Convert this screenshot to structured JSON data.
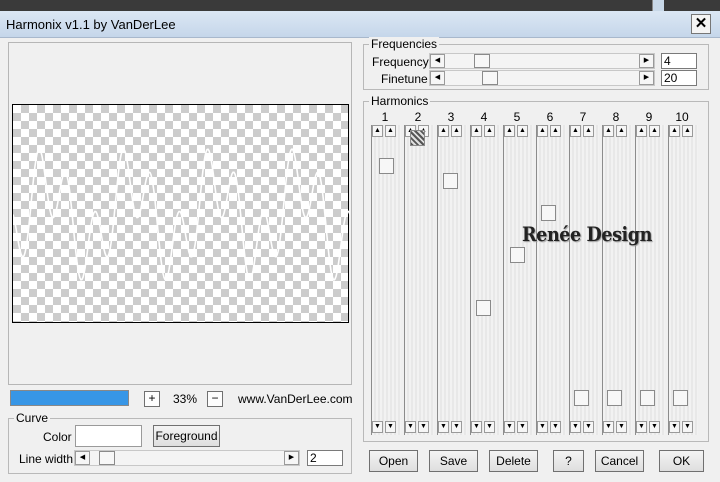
{
  "window": {
    "title": "Harmonix v1.1 by VanDerLee",
    "close_glyph": "✕"
  },
  "preview": {
    "progress": 1.0
  },
  "zoom": {
    "plus": "+",
    "value": "33%",
    "minus": "−"
  },
  "website": "www.VanDerLee.com",
  "curve": {
    "legend": "Curve",
    "color_label": "Color",
    "foreground_button": "Foreground",
    "line_width_label": "Line width",
    "line_width_value": "2"
  },
  "frequencies": {
    "legend": "Frequencies",
    "frequency_label": "Frequency",
    "frequency_value": "4",
    "finetune_label": "Finetune",
    "finetune_value": "20"
  },
  "harmonics": {
    "legend": "Harmonics",
    "columns": [
      "1",
      "2",
      "3",
      "4",
      "5",
      "6",
      "7",
      "8",
      "9",
      "10"
    ]
  },
  "watermark": "Renée Design",
  "buttons": {
    "open": "Open",
    "save": "Save",
    "delete": "Delete",
    "help": "?",
    "cancel": "Cancel",
    "ok": "OK"
  },
  "icons": {
    "arrow_left": "◀",
    "arrow_right": "▶",
    "arrow_up": "▲",
    "arrow_down": "▼"
  },
  "colors": {
    "title_bar": "#c5d6ea",
    "progress_fill": "#3796e6",
    "curve_color": "#ffffff"
  }
}
